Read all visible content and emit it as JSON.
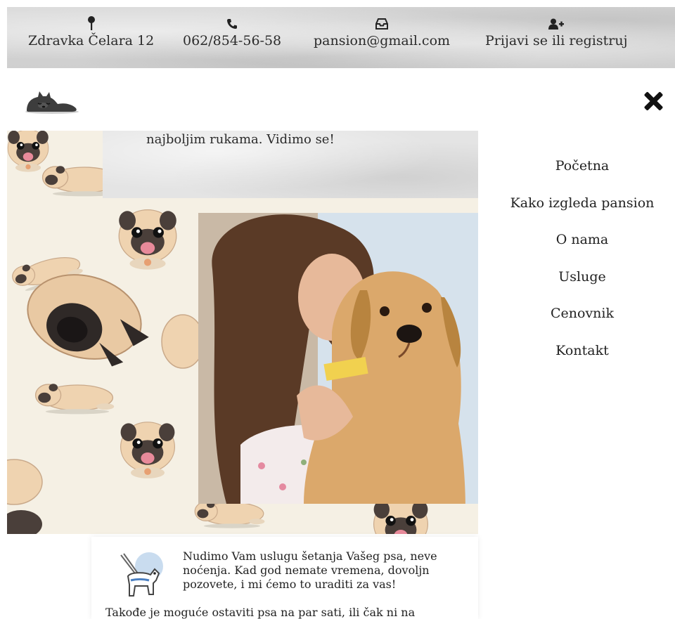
{
  "topbar": {
    "contacts": [
      {
        "icon": "map-pin-icon",
        "text": "Zdravka Čelara 12"
      },
      {
        "icon": "phone-icon",
        "text": "062/854-56-58"
      },
      {
        "icon": "inbox-icon",
        "text": "pansion@gmail.com"
      },
      {
        "icon": "user-plus-icon",
        "text": "Prijavi se ili registruj"
      }
    ]
  },
  "header": {
    "logo_icon": "sleeping-dog-logo-icon",
    "close_icon": "close-icon"
  },
  "hero": {
    "quote_text": "najboljim rukama. Vidimo se!",
    "photo_icon": "woman-with-dog-photo"
  },
  "nav": {
    "items": [
      "Početna",
      "Kako izgleda pansion",
      "O nama",
      "Usluge",
      "Cenovnik",
      "Kontakt"
    ]
  },
  "services": {
    "icon": "dog-walking-icon",
    "lines": [
      "Nudimo Vam uslugu šetanja Vašeg psa, neve",
      "noćenja. Kad god nemate vremena, dovoljn",
      "pozovete, i mi ćemo to uraditi za vas!"
    ],
    "extra": "Takođe je moguće ostaviti psa na par sati, ili čak ni na"
  },
  "colors": {
    "text": "#2b2b2b",
    "pug_bg": "#f5f0e4",
    "pug_fur": "#efd3b0",
    "pug_mask": "#4a3f3a"
  }
}
